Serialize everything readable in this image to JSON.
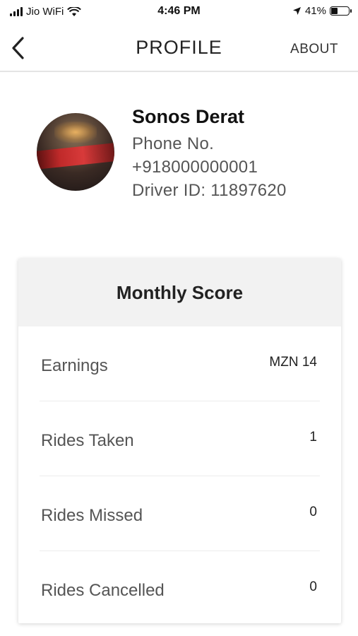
{
  "status_bar": {
    "carrier": "Jio WiFi",
    "time": "4:46 PM",
    "battery_percent": "41%",
    "battery_level": 0.41,
    "icons": [
      "signal-icon",
      "wifi-icon",
      "location-arrow-icon",
      "battery-icon"
    ]
  },
  "nav": {
    "title": "PROFILE",
    "about_label": "ABOUT",
    "back_icon": "chevron-left-icon"
  },
  "profile": {
    "name": "Sonos Derat",
    "phone_label": "Phone No.",
    "phone": "+918000000001",
    "driver_id": "Driver ID: 11897620"
  },
  "monthly_score": {
    "title": "Monthly Score",
    "rows": [
      {
        "label": "Earnings",
        "value": "MZN 14"
      },
      {
        "label": "Rides Taken",
        "value": "1"
      },
      {
        "label": "Rides Missed",
        "value": "0"
      },
      {
        "label": "Rides Cancelled",
        "value": "0"
      }
    ]
  }
}
